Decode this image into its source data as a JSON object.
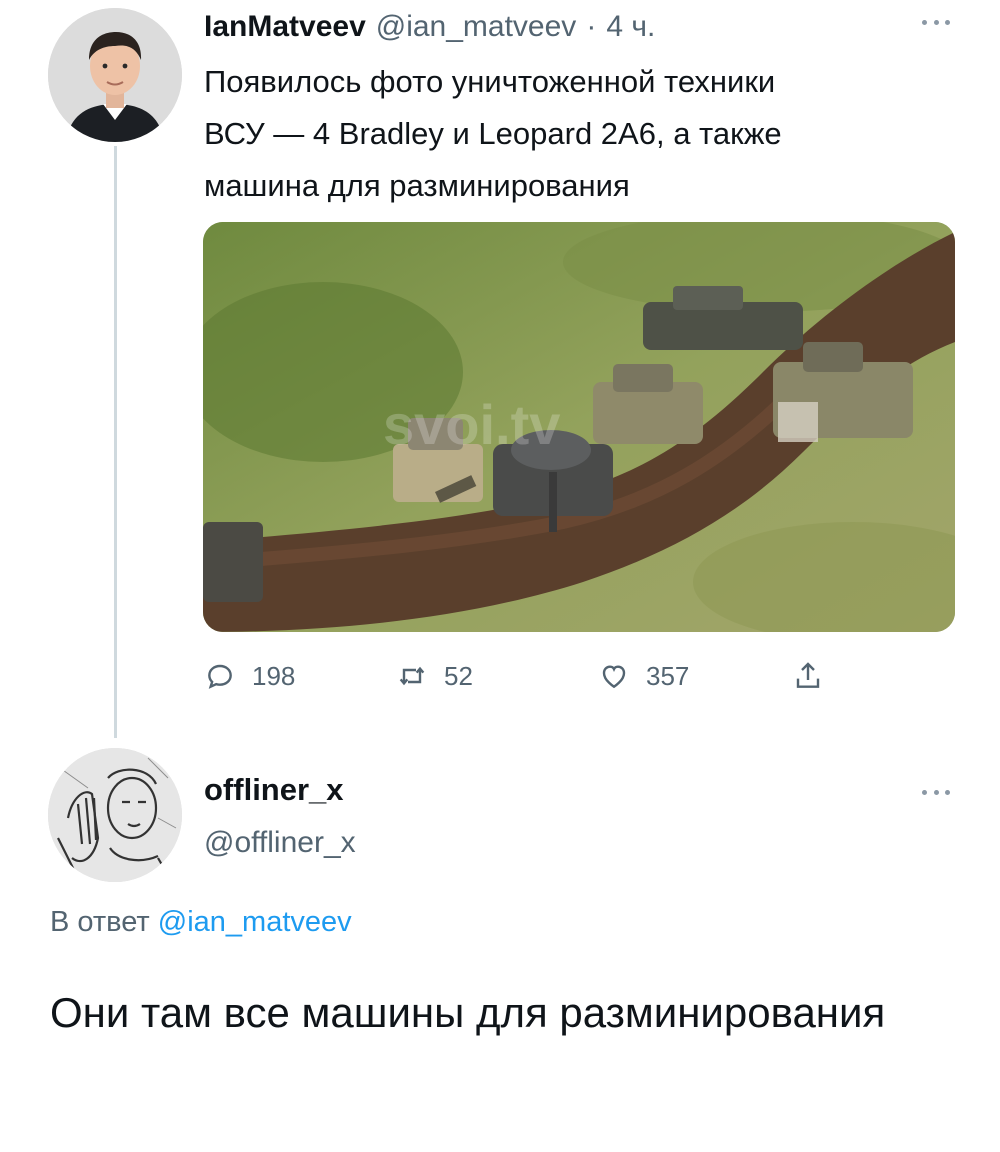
{
  "original_tweet": {
    "display_name": "IanMatveev",
    "handle": "@ian_matveev",
    "separator": "·",
    "time": "4 ч.",
    "text": "Появилось фото уничтоженной техники\nВСУ — 4 Bradley и Leopard 2A6, а также\nмашина для разминирования",
    "avatar_icon": "person-avatar",
    "more_icon": "more-horizontal-icon",
    "media": {
      "description_icon": "field-photo",
      "watermark": "svoi.tv"
    },
    "actions": {
      "reply_count": "198",
      "retweet_count": "52",
      "like_count": "357",
      "reply_icon": "reply-icon",
      "retweet_icon": "retweet-icon",
      "like_icon": "heart-icon",
      "share_icon": "share-icon"
    }
  },
  "reply_tweet": {
    "display_name": "offliner_x",
    "handle": "@offliner_x",
    "avatar_icon": "sketch-avatar",
    "more_icon": "more-horizontal-icon",
    "reply_to_prefix": "В ответ",
    "reply_to_mention": "@ian_matveev",
    "text": "Они там все машины для разминирования"
  },
  "colors": {
    "text_primary": "#0f1419",
    "text_secondary": "#536471",
    "link": "#1d9bf0",
    "thread_line": "#cfd9de"
  }
}
